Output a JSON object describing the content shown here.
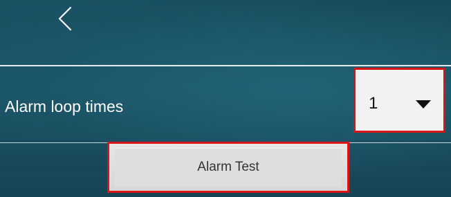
{
  "header": {
    "back_icon": "chevron-left-icon"
  },
  "settings": {
    "alarm_loop": {
      "label": "Alarm loop times",
      "selected_value": "1",
      "dropdown_icon": "caret-down-icon"
    }
  },
  "actions": {
    "alarm_test_label": "Alarm Test"
  },
  "colors": {
    "highlight_border": "#d81414",
    "background": "#1c5568",
    "divider": "#e8eef0"
  }
}
